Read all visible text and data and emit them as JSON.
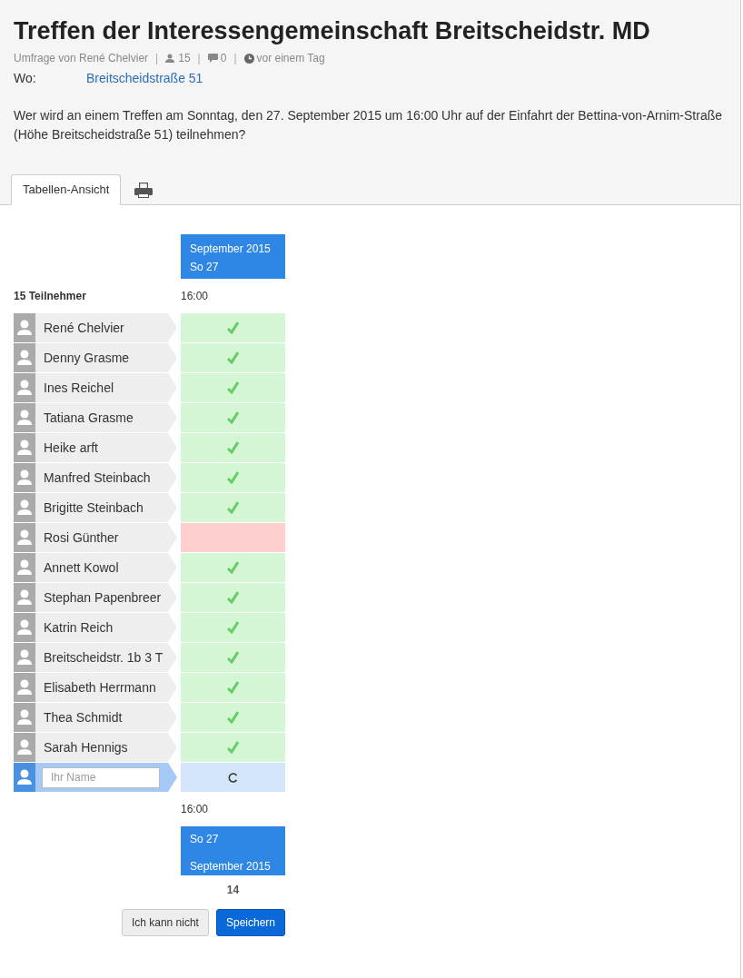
{
  "poll": {
    "title": "Treffen der Interessengemeinschaft Breitscheidstr. MD",
    "author": "Umfrage von René Chelvier",
    "participants": "15",
    "comments": "0",
    "time": "vor einem Tag",
    "separator": "|",
    "location_label": "Wo:",
    "location": "Breitscheidstraße 51",
    "question": "Wer wird an einem Treffen am Sonntag, den 27. September 2015 um 16:00 Uhr auf der Einfahrt der Bettina-von-Arnim-Straße (Höhe Breitscheidstraße 51) teilnehmen?"
  },
  "tabs": [
    {
      "kind": "text",
      "label": "Tabellen-Ansicht",
      "selected": true
    },
    {
      "kind": "print",
      "selected": false
    }
  ],
  "table": {
    "month_top": "September 2015",
    "day_top": "So 27",
    "participant_count": "15 Teilnehmer",
    "time_top": "16:00",
    "participants": [
      {
        "name": "René Chelvier",
        "attending": true
      },
      {
        "name": "Denny Grasme",
        "attending": true
      },
      {
        "name": "Ines Reichel",
        "attending": true
      },
      {
        "name": "Tatiana Grasme",
        "attending": true
      },
      {
        "name": "Heike arft",
        "attending": true
      },
      {
        "name": "Manfred Steinbach",
        "attending": true
      },
      {
        "name": "Brigitte Steinbach",
        "attending": true
      },
      {
        "name": "Rosi Günther",
        "attending": false
      },
      {
        "name": "Annett Kowol",
        "attending": true
      },
      {
        "name": "Stephan Papenbreer",
        "attending": true
      },
      {
        "name": "Katrin Reich",
        "attending": true
      },
      {
        "name": "Breitscheidstr. 1b 3 T",
        "attending": true
      },
      {
        "name": "Elisabeth Herrmann",
        "attending": true
      },
      {
        "name": "Thea Schmidt",
        "attending": true
      },
      {
        "name": "Sarah Hennigs",
        "attending": true
      }
    ],
    "new_entry": {
      "placeholder": "Ihr Name"
    },
    "time_bottom": "16:00",
    "day_bottom": "So 27",
    "month_bottom": "September 2015",
    "yes_count": "14"
  },
  "buttons": [
    {
      "label": "Ich kann nicht",
      "kind": "secondary"
    },
    {
      "label": "Speichern",
      "kind": "primary"
    }
  ]
}
